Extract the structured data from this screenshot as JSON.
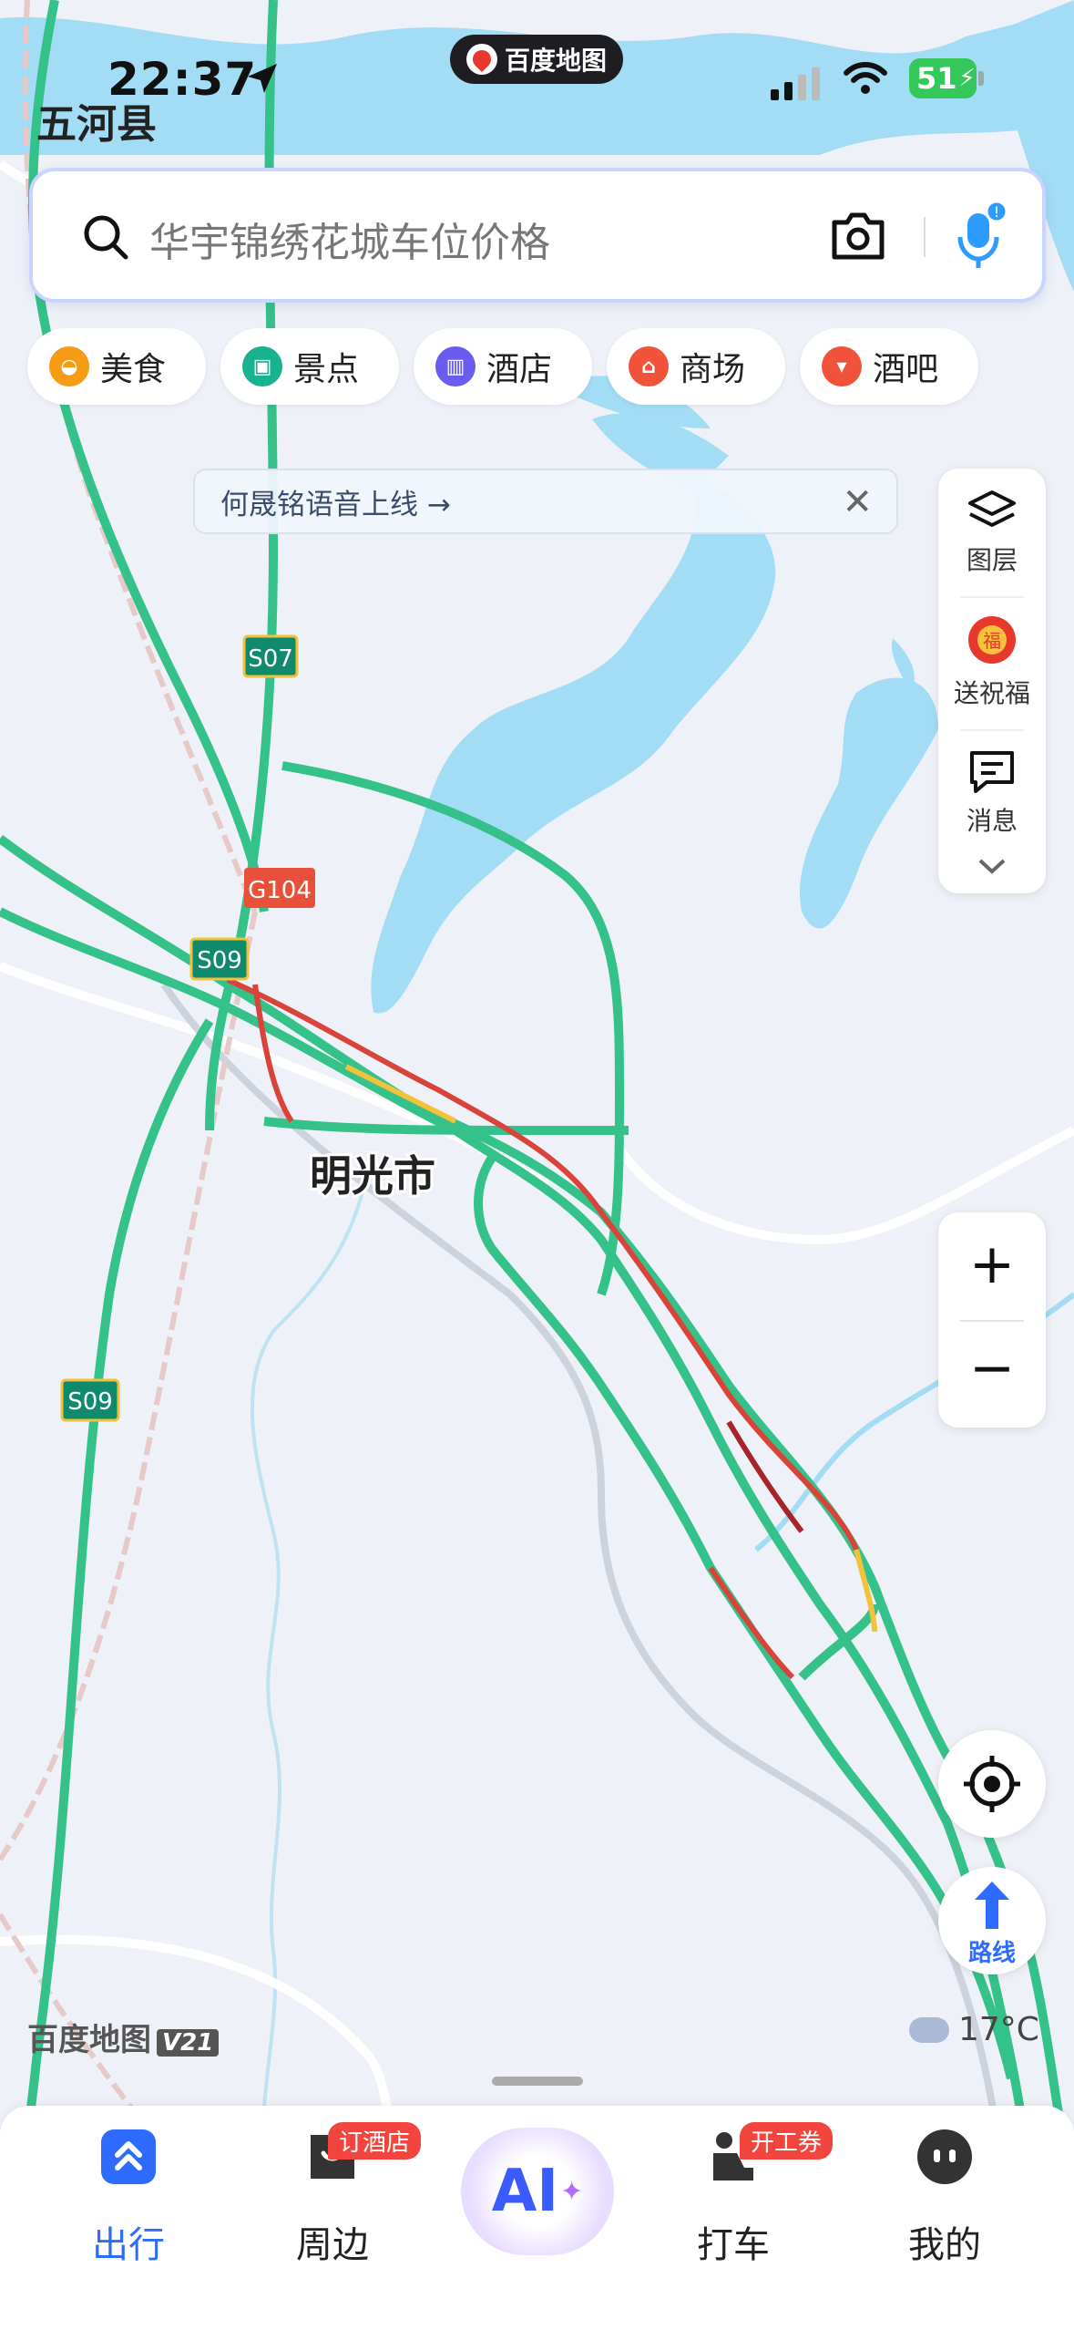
{
  "status_bar": {
    "time": "22:37",
    "battery": "51"
  },
  "app_pill": {
    "label": "百度地图"
  },
  "map": {
    "county_label": "五河县",
    "city_label": "明光市",
    "road_shields": [
      {
        "label": "S07",
        "color": "#0f8a6c"
      },
      {
        "label": "G104",
        "color": "#e8503a"
      },
      {
        "label": "S09",
        "color": "#0f8a6c"
      },
      {
        "label": "S09",
        "color": "#0f8a6c"
      }
    ],
    "watermark": "百度地图",
    "version": "V21",
    "weather": "17°C"
  },
  "search": {
    "placeholder": "华宇锦绣花城车位价格"
  },
  "categories": [
    {
      "label": "美食",
      "icon": "food-icon",
      "color": "#f59b16"
    },
    {
      "label": "景点",
      "icon": "scenic-icon",
      "color": "#17b38f"
    },
    {
      "label": "酒店",
      "icon": "hotel-icon",
      "color": "#6b5cf0"
    },
    {
      "label": "商场",
      "icon": "mall-icon",
      "color": "#f0523a"
    },
    {
      "label": "酒吧",
      "icon": "bar-icon",
      "color": "#f0523a"
    }
  ],
  "banner": {
    "text": "何晟铭语音上线 →"
  },
  "side_panel": {
    "layers": "图层",
    "blessing": "送祝福",
    "messages": "消息"
  },
  "zoom": {
    "plus": "+",
    "minus": "−"
  },
  "route": {
    "label": "路线"
  },
  "bottom_nav": {
    "items": [
      {
        "label": "出行",
        "active": true
      },
      {
        "label": "周边",
        "badge": "订酒店"
      },
      {
        "label": "AI"
      },
      {
        "label": "打车",
        "badge": "开工券"
      },
      {
        "label": "我的"
      }
    ]
  },
  "colors": {
    "accent": "#2e6bff",
    "road": "#35c18a",
    "water": "#a3dcf5",
    "congested": "#d9433a"
  }
}
